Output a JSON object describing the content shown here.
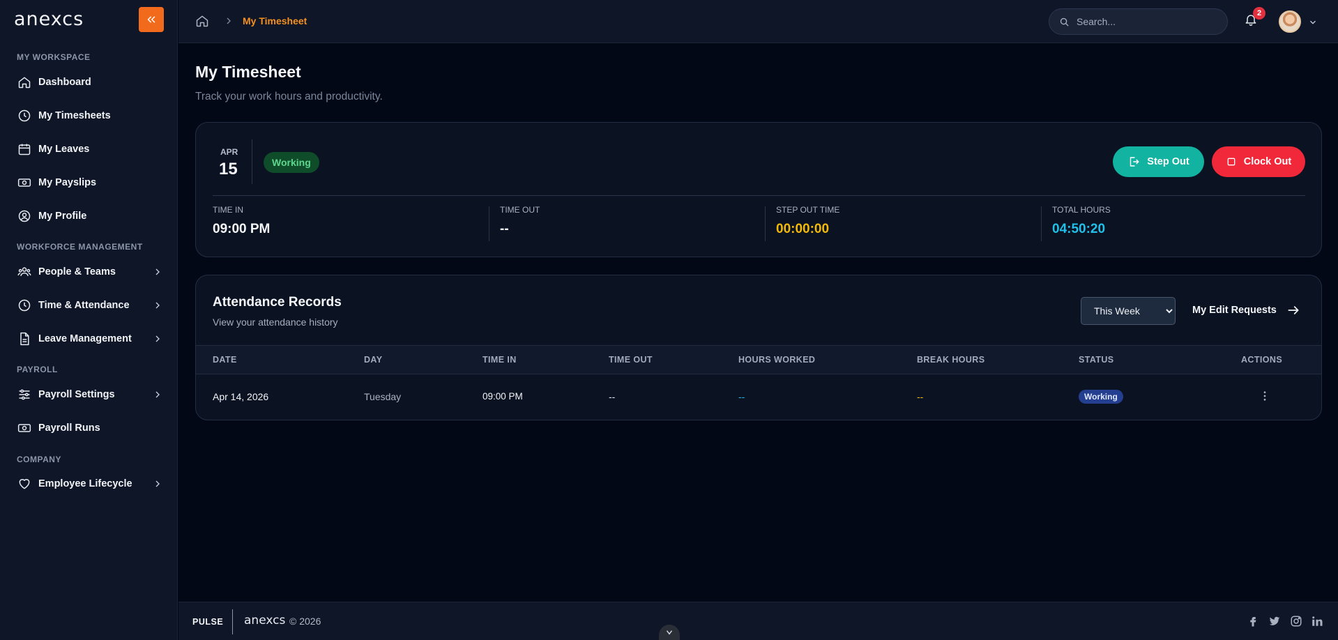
{
  "app": {
    "brand": "anexcs"
  },
  "sidebar": {
    "sections": [
      {
        "title": "MY WORKSPACE"
      },
      {
        "title": "WORKFORCE MANAGEMENT"
      },
      {
        "title": "PAYROLL"
      },
      {
        "title": "COMPANY"
      }
    ],
    "items": [
      {
        "label": "Dashboard",
        "icon": "home-icon"
      },
      {
        "label": "My Timesheets",
        "icon": "clock-icon"
      },
      {
        "label": "My Leaves",
        "icon": "calendar-icon"
      },
      {
        "label": "My Payslips",
        "icon": "money-icon"
      },
      {
        "label": "My Profile",
        "icon": "user-circle-icon"
      },
      {
        "label": "People & Teams",
        "icon": "users-icon",
        "expandable": true
      },
      {
        "label": "Time & Attendance",
        "icon": "clock-icon",
        "expandable": true
      },
      {
        "label": "Leave Management",
        "icon": "document-icon",
        "expandable": true
      },
      {
        "label": "Payroll Settings",
        "icon": "sliders-icon",
        "expandable": true
      },
      {
        "label": "Payroll Runs",
        "icon": "money-icon"
      },
      {
        "label": "Employee Lifecycle",
        "icon": "heart-icon",
        "expandable": true
      }
    ]
  },
  "topbar": {
    "breadcrumb_current": "My Timesheet",
    "search_placeholder": "Search...",
    "notification_count": "2"
  },
  "page": {
    "title": "My Timesheet",
    "subtitle": "Track your work hours and productivity."
  },
  "status_card": {
    "month": "APR",
    "day": "15",
    "status": "Working",
    "step_out_label": "Step Out",
    "clock_out_label": "Clock Out",
    "stats": [
      {
        "label": "TIME IN",
        "value": "09:00 PM",
        "color": "#f4f6fa"
      },
      {
        "label": "TIME OUT",
        "value": "--",
        "color": "#f4f6fa"
      },
      {
        "label": "STEP OUT TIME",
        "value": "00:00:00",
        "color": "#f0b90b"
      },
      {
        "label": "TOTAL HOURS",
        "value": "04:50:20",
        "color": "#22c0e8"
      }
    ]
  },
  "records": {
    "title": "Attendance Records",
    "subtitle": "View your attendance history",
    "filter_selected": "This Week",
    "edit_requests_label": "My Edit Requests",
    "columns": [
      "DATE",
      "DAY",
      "TIME IN",
      "TIME OUT",
      "HOURS WORKED",
      "BREAK HOURS",
      "STATUS",
      "ACTIONS"
    ],
    "rows": [
      {
        "date": "Apr 14, 2026",
        "day": "Tuesday",
        "time_in": "09:00 PM",
        "time_out": "--",
        "hours_worked": "--",
        "break_hours": "--",
        "status": "Working"
      }
    ]
  },
  "footer": {
    "product": "PULSE",
    "brand": "anexcs",
    "copyright": "© 2026",
    "social": [
      "facebook-icon",
      "twitter-icon",
      "instagram-icon",
      "linkedin-icon"
    ]
  },
  "colors": {
    "accent": "#f26a1b",
    "step_out": "#12b3a0",
    "clock_out": "#f0283a",
    "working_green": "#5fd68c"
  }
}
